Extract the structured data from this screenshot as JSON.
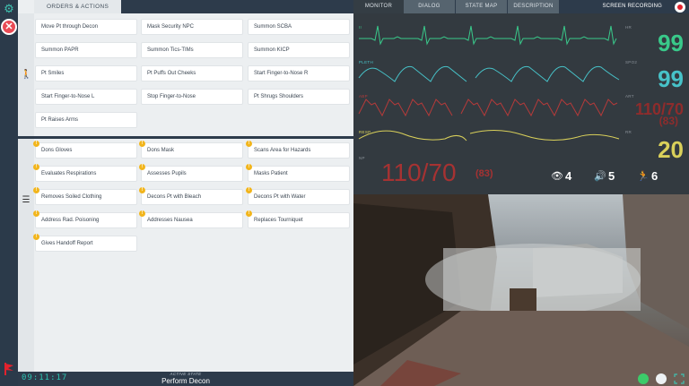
{
  "left_tab": {
    "label": "ORDERS & ACTIONS"
  },
  "orders": [
    "Move Pt through Decon",
    "Mask Security NPC",
    "Summon SCBA",
    "Summon PAPR",
    "Summon Tics-TIMs",
    "Summon KICP",
    "Pt Smiles",
    "Pt Puffs Out Cheeks",
    "Start Finger-to-Nose R",
    "Start Finger-to-Nose L",
    "Stop Finger-to-Nose",
    "Pt Shrugs Shoulders",
    "Pt Raises Arms"
  ],
  "actions": [
    "Dons Gloves",
    "Dons Mask",
    "Scans Area for Hazards",
    "Evaluates Respirations",
    "Assesses Pupils",
    "Masks Patient",
    "Removes Soiled Clothing",
    "Decons Pt with Bleach",
    "Decons Pt with Water",
    "Address Rad. Poisoning",
    "Addresses Nausea",
    "Replaces Tourniquet",
    "Gives Handoff Report"
  ],
  "footer": {
    "timer": "09:11:17",
    "state_caption": "ACTIVE STATE",
    "state_value": "Perform Decon"
  },
  "right_tabs": [
    "MONITOR",
    "DIALOG",
    "STATE MAP",
    "DESCRIPTION"
  ],
  "recording_label": "SCREEN RECORDING",
  "monitor": {
    "waves": [
      {
        "label": "II",
        "vlabel": "HR",
        "value": "99",
        "color": "#39c98a"
      },
      {
        "label": "PLETH",
        "vlabel": "SPO2",
        "value": "99",
        "color": "#47c2c8"
      },
      {
        "label": "ABP",
        "vlabel": "ART",
        "value": "110/70",
        "sub": "(83)",
        "color": "#b53a3a"
      },
      {
        "label": "RESP",
        "vlabel": "RR",
        "value": "20",
        "color": "#d9d05a"
      }
    ],
    "nibp_label": "NP",
    "nibp_value": "110/70",
    "nibp_sub": "(83)",
    "stats": {
      "eye": "4",
      "sound": "5",
      "motor": "6"
    }
  },
  "colors": {
    "accent": "#2cc3b0",
    "dark": "#2d3b4b",
    "badge": "#f2b51c",
    "record": "#e3222d"
  },
  "icons": {
    "settings": "gear-icon",
    "close": "close-icon",
    "orders": "walking-person-icon",
    "actions": "list-icon"
  }
}
